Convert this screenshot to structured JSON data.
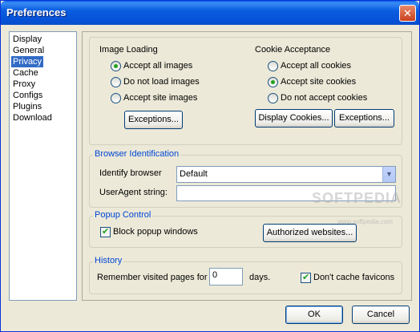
{
  "window": {
    "title": "Preferences",
    "close_symbol": "✕"
  },
  "nav": {
    "items": [
      "Display",
      "General",
      "Privacy",
      "Cache",
      "Proxy",
      "Configs",
      "Plugins",
      "Download"
    ],
    "selected": "Privacy"
  },
  "image_loading": {
    "heading": "Image Loading",
    "options": [
      "Accept all images",
      "Do not load images",
      "Accept site images"
    ],
    "selected": "Accept all images",
    "exceptions_label": "Exceptions..."
  },
  "cookie_acceptance": {
    "heading": "Cookie Acceptance",
    "options": [
      "Accept all cookies",
      "Accept site cookies",
      "Do not accept cookies"
    ],
    "selected": "Accept site cookies",
    "display_cookies_label": "Display Cookies...",
    "exceptions_label": "Exceptions..."
  },
  "browser_identification": {
    "title": "Browser Identification",
    "identify_label": "Identify browser",
    "identify_value": "Default",
    "useragent_label": "UserAgent string:",
    "useragent_value": ""
  },
  "popup_control": {
    "title": "Popup Control",
    "block_label": "Block popup windows",
    "block_checked": true,
    "authorized_label": "Authorized websites..."
  },
  "history": {
    "title": "History",
    "remember_label": "Remember visited pages for",
    "days_value": "0",
    "days_unit": "days.",
    "favicons_label": "Don't cache favicons",
    "favicons_checked": true
  },
  "buttons": {
    "ok": "OK",
    "cancel": "Cancel"
  },
  "watermark": {
    "text": "SOFTPEDIA",
    "sub": "www.softpedia.com"
  }
}
